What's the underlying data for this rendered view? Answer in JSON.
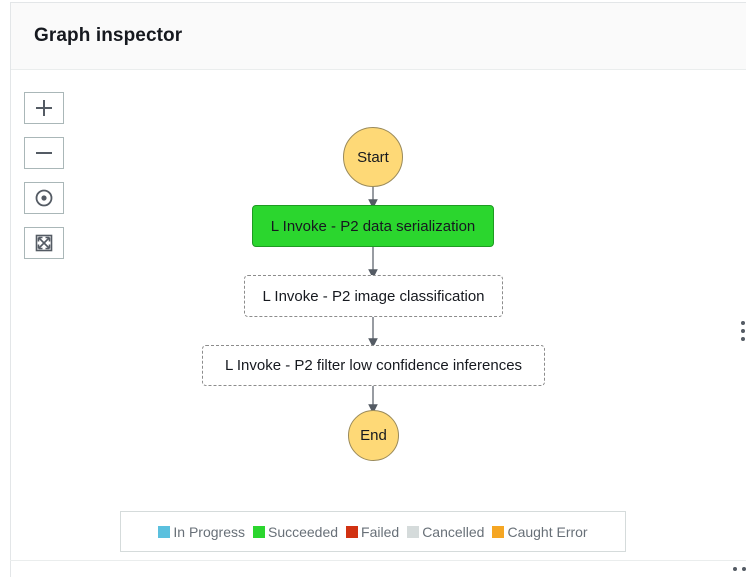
{
  "panel": {
    "title": "Graph inspector"
  },
  "zoom_controls": [
    {
      "icon": "plus-icon",
      "label": "Zoom in"
    },
    {
      "icon": "minus-icon",
      "label": "Zoom out"
    },
    {
      "icon": "center-icon",
      "label": "Center"
    },
    {
      "icon": "fit-icon",
      "label": "Fit to view"
    }
  ],
  "graph": {
    "start": {
      "label": "Start",
      "color": "#fed977"
    },
    "states": [
      {
        "label": "L Invoke - P2 data serialization",
        "status": "Succeeded"
      },
      {
        "label": "L Invoke - P2 image classification",
        "status": "Not started"
      },
      {
        "label": "L Invoke - P2 filter low confidence inferences",
        "status": "Not started"
      }
    ],
    "end": {
      "label": "End",
      "color": "#fed977"
    }
  },
  "legend": [
    {
      "label": "In Progress",
      "color": "#5bc0de"
    },
    {
      "label": "Succeeded",
      "color": "#2bd62e"
    },
    {
      "label": "Failed",
      "color": "#d13212"
    },
    {
      "label": "Cancelled",
      "color": "#d5dbdb"
    },
    {
      "label": "Caught Error",
      "color": "#f5a623"
    }
  ],
  "colors": {
    "succeeded": "#2bd62e",
    "start_end": "#fed977",
    "edge": "#545b64"
  }
}
